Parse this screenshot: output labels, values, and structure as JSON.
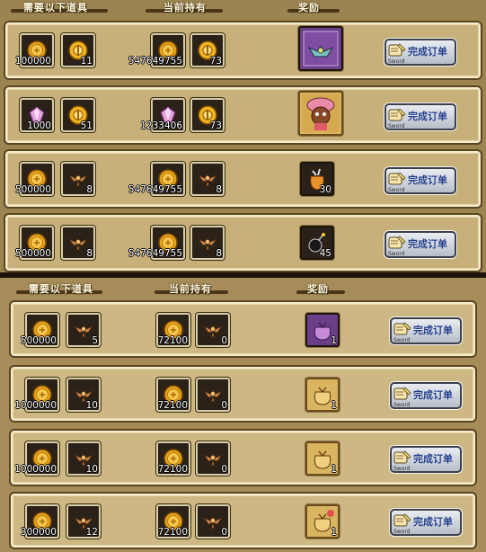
{
  "headers": {
    "required": "需要以下道具",
    "held": "当前持有",
    "reward": "奖励"
  },
  "button": {
    "label": "完成订单",
    "sub": "Sword"
  },
  "top_rows": [
    {
      "req1": "100000",
      "req2": "11",
      "held1": "547649755",
      "held2": "73",
      "reward_count": ""
    },
    {
      "req1": "1000",
      "req2": "51",
      "held1": "1233406",
      "held2": "73",
      "reward_count": ""
    },
    {
      "req1": "500000",
      "req2": "8",
      "held1": "547649755",
      "held2": "8",
      "reward_count": "30"
    },
    {
      "req1": "500000",
      "req2": "8",
      "held1": "547649755",
      "held2": "8",
      "reward_count": "45"
    }
  ],
  "bottom_rows": [
    {
      "req1": "500000",
      "req2": "5",
      "held1": "72100",
      "held2": "0",
      "reward_count": "1"
    },
    {
      "req1": "1000000",
      "req2": "10",
      "held1": "72100",
      "held2": "0",
      "reward_count": "1"
    },
    {
      "req1": "1000000",
      "req2": "10",
      "held1": "72100",
      "held2": "0",
      "reward_count": "1"
    },
    {
      "req1": "300000",
      "req2": "12",
      "held1": "72100",
      "held2": "0",
      "reward_count": "1"
    }
  ],
  "icons": {
    "coin": "gold-coin-icon",
    "token": "gold-token-icon",
    "gem": "pink-gem-icon",
    "badge": "winged-badge-icon",
    "quest": "quest-scroll-icon"
  },
  "colors": {
    "panel": "#9c8450",
    "row": "#c7b07a",
    "button_text": "#1e3a8a"
  }
}
